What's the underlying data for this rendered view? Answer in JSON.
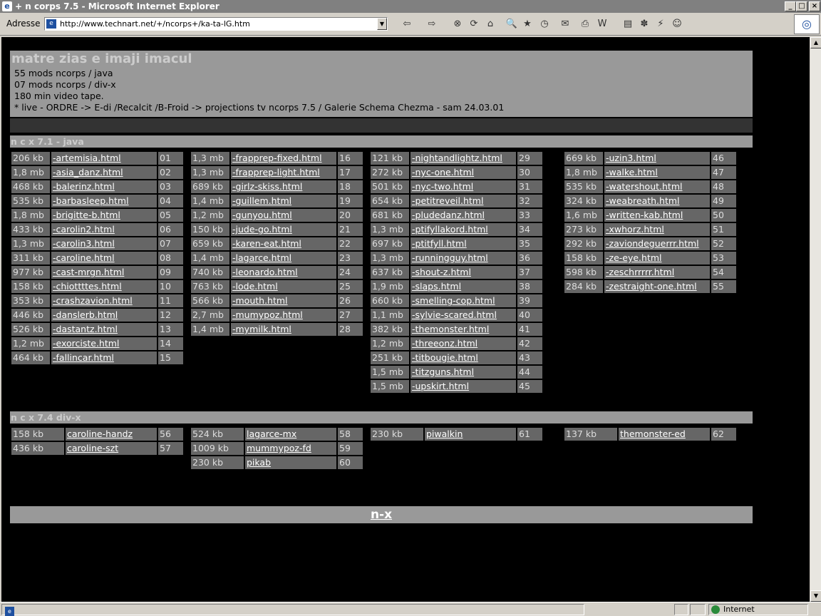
{
  "window": {
    "title": "+ n corps 7.5 - Microsoft Internet Explorer",
    "minimize": "_",
    "maximize": "□",
    "close": "×"
  },
  "toolbar": {
    "address_label": "Adresse",
    "url": "http://www.technart.net/+/ncorps+/ka-ta-lG.htm"
  },
  "status": {
    "zone": "Internet"
  },
  "page": {
    "title": "matre zias e imaji imacul",
    "lines": [
      "55 mods ncorps / java",
      "07 mods ncorps / div-x",
      "180 min video tape.",
      "* live - ORDRE -> E-di /Recalcit /B-Froid -> projections tv ncorps 7.5 / Galerie Schema Chezma - sam 24.03.01"
    ],
    "section_java": "n c x 7.1 - java",
    "section_divx": "n c x 7.4 div-x",
    "footer_link": "n-x"
  },
  "java_columns": [
    [
      {
        "size": "206 kb",
        "file": "-artemisia.html",
        "num": "01"
      },
      {
        "size": "1,8 mb",
        "file": "-asia_danz.html",
        "num": "02"
      },
      {
        "size": "468 kb",
        "file": "-balerinz.html",
        "num": "03"
      },
      {
        "size": "535 kb",
        "file": "-barbasleep.html",
        "num": "04"
      },
      {
        "size": "1,8 mb",
        "file": "-brigitte-b.html",
        "num": "05"
      },
      {
        "size": "433 kb",
        "file": "-carolin2.html",
        "num": "06"
      },
      {
        "size": "1,3 mb",
        "file": "-carolin3.html",
        "num": "07"
      },
      {
        "size": "311 kb",
        "file": "-caroline.html",
        "num": "08"
      },
      {
        "size": "977 kb",
        "file": "-cast-mrgn.html",
        "num": "09"
      },
      {
        "size": "158 kb",
        "file": "-chiottttes.html",
        "num": "10"
      },
      {
        "size": "353 kb",
        "file": "-crashzavion.html",
        "num": "11"
      },
      {
        "size": "446 kb",
        "file": "-danslerb.html",
        "num": "12"
      },
      {
        "size": "526 kb",
        "file": "-dastantz.html",
        "num": "13"
      },
      {
        "size": "1,2 mb",
        "file": "-exorciste.html",
        "num": "14"
      },
      {
        "size": "464 kb",
        "file": "-fallincar.html",
        "num": "15"
      }
    ],
    [
      {
        "size": "1,3 mb",
        "file": "-frapprep-fixed.html",
        "num": "16"
      },
      {
        "size": "1,3 mb",
        "file": "-frapprep-light.html",
        "num": "17"
      },
      {
        "size": "689 kb",
        "file": "-girlz-skiss.html",
        "num": "18"
      },
      {
        "size": "1,4 mb",
        "file": "-guillem.html",
        "num": "19"
      },
      {
        "size": "1,2 mb",
        "file": "-gunyou.html",
        "num": "20"
      },
      {
        "size": "150 kb",
        "file": "-jude-go.html",
        "num": "21"
      },
      {
        "size": "659 kb",
        "file": "-karen-eat.html",
        "num": "22"
      },
      {
        "size": "1,4 mb",
        "file": "-lagarce.html",
        "num": "23"
      },
      {
        "size": "740 kb",
        "file": "-leonardo.html",
        "num": "24"
      },
      {
        "size": "763 kb",
        "file": "-lode.html",
        "num": "25"
      },
      {
        "size": "566 kb",
        "file": "-mouth.html",
        "num": "26"
      },
      {
        "size": "2,7 mb",
        "file": "-mumypoz.html",
        "num": "27"
      },
      {
        "size": "1,4 mb",
        "file": "-mymilk.html",
        "num": "28"
      }
    ],
    [
      {
        "size": "121 kb",
        "file": "-nightandlightz.html",
        "num": "29"
      },
      {
        "size": "272 kb",
        "file": "-nyc-one.html",
        "num": "30"
      },
      {
        "size": "501 kb",
        "file": "-nyc-two.html",
        "num": "31"
      },
      {
        "size": "654 kb",
        "file": "-petitreveil.html",
        "num": "32"
      },
      {
        "size": "681 kb",
        "file": "-pludedanz.html",
        "num": "33"
      },
      {
        "size": "1,3 mb",
        "file": "-ptifyllakord.html",
        "num": "34"
      },
      {
        "size": "697 kb",
        "file": "-ptitfyll.html",
        "num": "35"
      },
      {
        "size": "1,3 mb",
        "file": "-runningguy.html",
        "num": "36"
      },
      {
        "size": "637 kb",
        "file": "-shout-z.html",
        "num": "37"
      },
      {
        "size": "1,9 mb",
        "file": "-slaps.html",
        "num": "38"
      },
      {
        "size": "660 kb",
        "file": "-smelling-cop.html",
        "num": "39"
      },
      {
        "size": "1,1 mb",
        "file": "-sylvie-scared.html",
        "num": "40"
      },
      {
        "size": "382 kb",
        "file": "-themonster.html",
        "num": "41"
      },
      {
        "size": "1,2 mb",
        "file": "-threeonz.html",
        "num": "42"
      },
      {
        "size": "251 kb",
        "file": "-titbougie.html",
        "num": "43"
      },
      {
        "size": "1,5 mb",
        "file": "-titzguns.html",
        "num": "44"
      },
      {
        "size": "1,5 mb",
        "file": "-upskirt.html",
        "num": "45"
      }
    ],
    [
      {
        "size": "669 kb",
        "file": "-uzin3.html",
        "num": "46"
      },
      {
        "size": "1,8 mb",
        "file": "-walke.html",
        "num": "47"
      },
      {
        "size": "535 kb",
        "file": "-watershout.html",
        "num": "48"
      },
      {
        "size": "324 kb",
        "file": "-weabreath.html",
        "num": "49"
      },
      {
        "size": "1,6 mb",
        "file": "-written-kab.html",
        "num": "50"
      },
      {
        "size": "273 kb",
        "file": "-xwhorz.html",
        "num": "51"
      },
      {
        "size": "292 kb",
        "file": "-zaviondeguerrr.html",
        "num": "52"
      },
      {
        "size": "158 kb",
        "file": "-ze-eye.html",
        "num": "53"
      },
      {
        "size": "598 kb",
        "file": "-zeschrrrrr.html",
        "num": "54"
      },
      {
        "size": "284 kb",
        "file": "-zestraight-one.html",
        "num": "55"
      }
    ]
  ],
  "divx_columns": [
    [
      {
        "size": "158 kb",
        "file": "caroline-handz",
        "num": "56"
      },
      {
        "size": "436 kb",
        "file": "caroline-szt",
        "num": "57"
      }
    ],
    [
      {
        "size": "524 kb",
        "file": "lagarce-mx",
        "num": "58"
      },
      {
        "size": "1009 kb",
        "file": "mummypoz-fd",
        "num": "59"
      },
      {
        "size": "230 kb",
        "file": "pikab",
        "num": "60"
      }
    ],
    [
      {
        "size": "230 kb",
        "file": "piwalkin",
        "num": "61"
      }
    ],
    [
      {
        "size": "137 kb",
        "file": "themonster-ed",
        "num": "62"
      }
    ]
  ],
  "icons": {
    "ie": "e",
    "page": "e",
    "back": "⇦",
    "forward": "⇨",
    "stop": "⊗",
    "refresh": "⟳",
    "home": "⌂",
    "search": "🔍",
    "favorites": "★",
    "history": "◷",
    "mail": "✉",
    "print": "⎙",
    "edit": "W",
    "discuss": "▤",
    "messenger": "✽",
    "tools": "⚡",
    "person": "☺",
    "brand": "◎",
    "scroll_up": "▲",
    "scroll_down": "▼"
  }
}
